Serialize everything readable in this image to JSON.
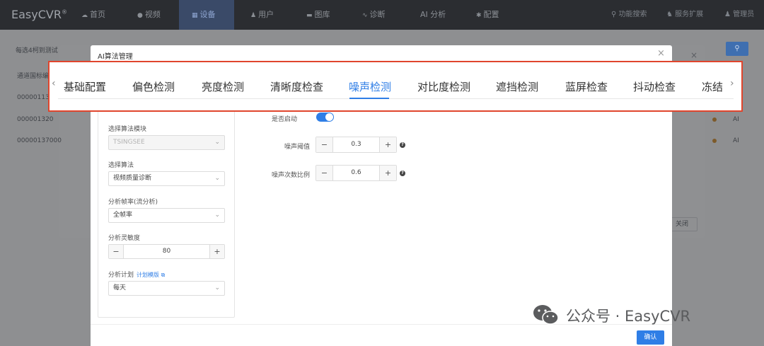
{
  "nav": {
    "logo": "EasyCVR",
    "logo_mark": "®",
    "items": [
      {
        "label": "首页",
        "icon": "cloud-icon",
        "glyph": "☁"
      },
      {
        "label": "视频",
        "icon": "video-icon",
        "glyph": "●"
      },
      {
        "label": "设备",
        "icon": "device-icon",
        "glyph": "▦"
      },
      {
        "label": "用户",
        "icon": "user-icon",
        "glyph": "♟"
      },
      {
        "label": "图库",
        "icon": "gallery-icon",
        "glyph": "▬"
      },
      {
        "label": "诊断",
        "icon": "diagnose-icon",
        "glyph": "∿"
      },
      {
        "label": "AI 分析",
        "icon": "",
        "glyph": ""
      },
      {
        "label": "配置",
        "icon": "gear-icon",
        "glyph": "✱"
      }
    ],
    "active_index": 2,
    "right": {
      "search": "功能搜索",
      "service": "服务扩展",
      "admin": "管理员"
    }
  },
  "background": {
    "crumb": "每选4柯到测试",
    "table_head": "通道国标编",
    "rows": [
      "000001131",
      "000001320",
      "00000137000"
    ],
    "right_col": [
      "AI",
      "AI"
    ],
    "close": "关闭"
  },
  "modal": {
    "title": "AI算法管理",
    "close_glyph": "×",
    "tabs": [
      "基础配置",
      "偏色检测",
      "亮度检测",
      "清晰度检查",
      "噪声检测",
      "对比度检测",
      "遮挡检测",
      "蓝屏检查",
      "抖动检查",
      "冻结"
    ],
    "active_tab": 4,
    "left": {
      "module_label": "选择算法模块",
      "module_value": "TSINGSEE",
      "algo_label": "选择算法",
      "algo_value": "视频质量诊断",
      "framerate_label": "分析帧率(流分析)",
      "framerate_value": "全帧率",
      "sensitivity_label": "分析灵敏度",
      "sensitivity_value": "80",
      "plan_label": "分析计划",
      "plan_link": "计划模版",
      "plan_value": "每天"
    },
    "right": {
      "enable_label": "是否启动",
      "enabled": true,
      "threshold_label": "噪声阈值",
      "threshold_value": "0.3",
      "ratio_label": "噪声次数比例",
      "ratio_value": "0.6"
    },
    "confirm": "确认"
  },
  "watermark": {
    "text": "公众号 · EasyCVR"
  },
  "colors": {
    "accent": "#2f7ee6",
    "highlight_border": "#e0452d",
    "nav_bg": "#2b2d31"
  }
}
